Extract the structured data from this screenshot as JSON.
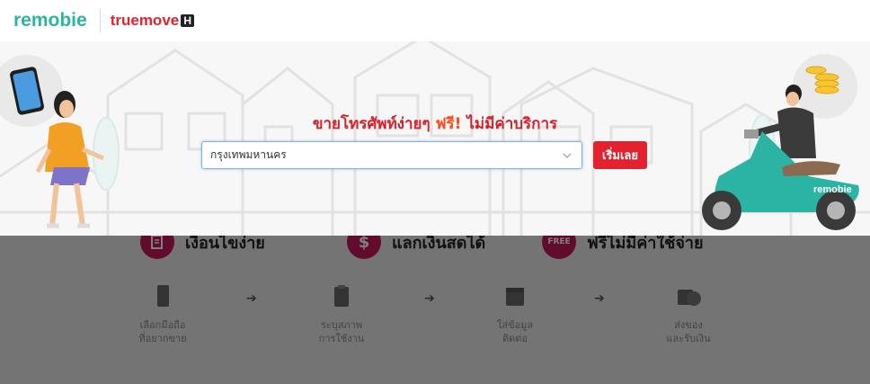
{
  "header": {
    "brand_left": "remobie",
    "brand_right_main": "truemove",
    "brand_right_badge": "H"
  },
  "hero": {
    "title_part1": "ขายโทรศัพท์ง่ายๆ ",
    "title_free": "ฟรี!",
    "title_part2": " ไม่มีค่าบริการ",
    "province_select_value": "กรุงเทพมหานคร",
    "start_button": "เริ่มเลย",
    "scooter_brand": "remobie"
  },
  "features": [
    {
      "label": "เงื่อนไขง่าย",
      "icon": "document-check-icon"
    },
    {
      "label": "แลกเงินสดได้",
      "icon": "dollar-check-icon"
    },
    {
      "label": "ฟรีไม่มีค่าใช้จ่าย",
      "badge": "FREE",
      "icon": "free-check-icon"
    }
  ],
  "steps": [
    {
      "line1": "เลือกมือถือ",
      "line2": "ที่อยากขาย",
      "icon": "phone-icon"
    },
    {
      "line1": "ระบุสภาพ",
      "line2": "การใช้งาน",
      "icon": "clipboard-icon"
    },
    {
      "line1": "ใส่ข้อมูล",
      "line2": "ติดต่อ",
      "icon": "calendar-icon"
    },
    {
      "line1": "ส่งของ",
      "line2": "และรับเงิน",
      "icon": "box-check-icon"
    }
  ],
  "colors": {
    "brand_teal": "#2bb3a3",
    "true_red": "#e3222d",
    "free_orange": "#ff4a1c"
  }
}
